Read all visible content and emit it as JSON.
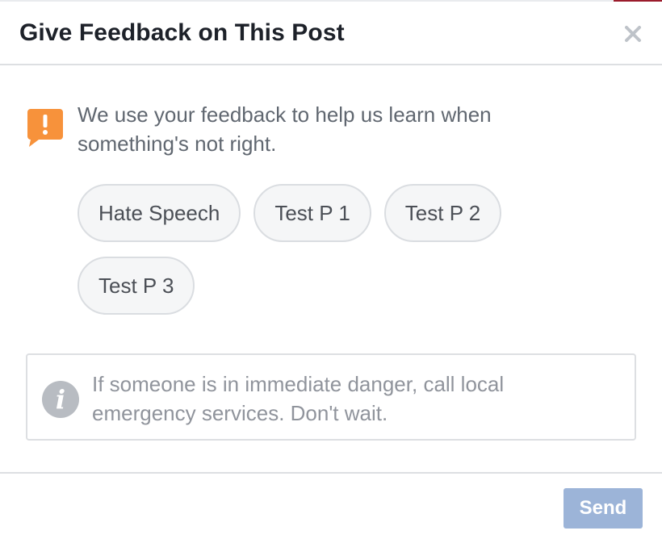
{
  "dialog": {
    "title": "Give Feedback on This Post",
    "close_icon": "close-icon"
  },
  "notice": {
    "icon": "exclamation-speech-bubble-icon",
    "icon_color": "#f7923b",
    "text": "We use your feedback to help us learn when something's not right."
  },
  "options": [
    {
      "label": "Hate Speech"
    },
    {
      "label": "Test P 1"
    },
    {
      "label": "Test P 2"
    },
    {
      "label": "Test P 3"
    }
  ],
  "info": {
    "icon": "info-icon",
    "text": "If someone is in immediate danger, call local emergency services. Don't wait."
  },
  "footer": {
    "send_label": "Send",
    "send_color": "#9cb4d8"
  }
}
